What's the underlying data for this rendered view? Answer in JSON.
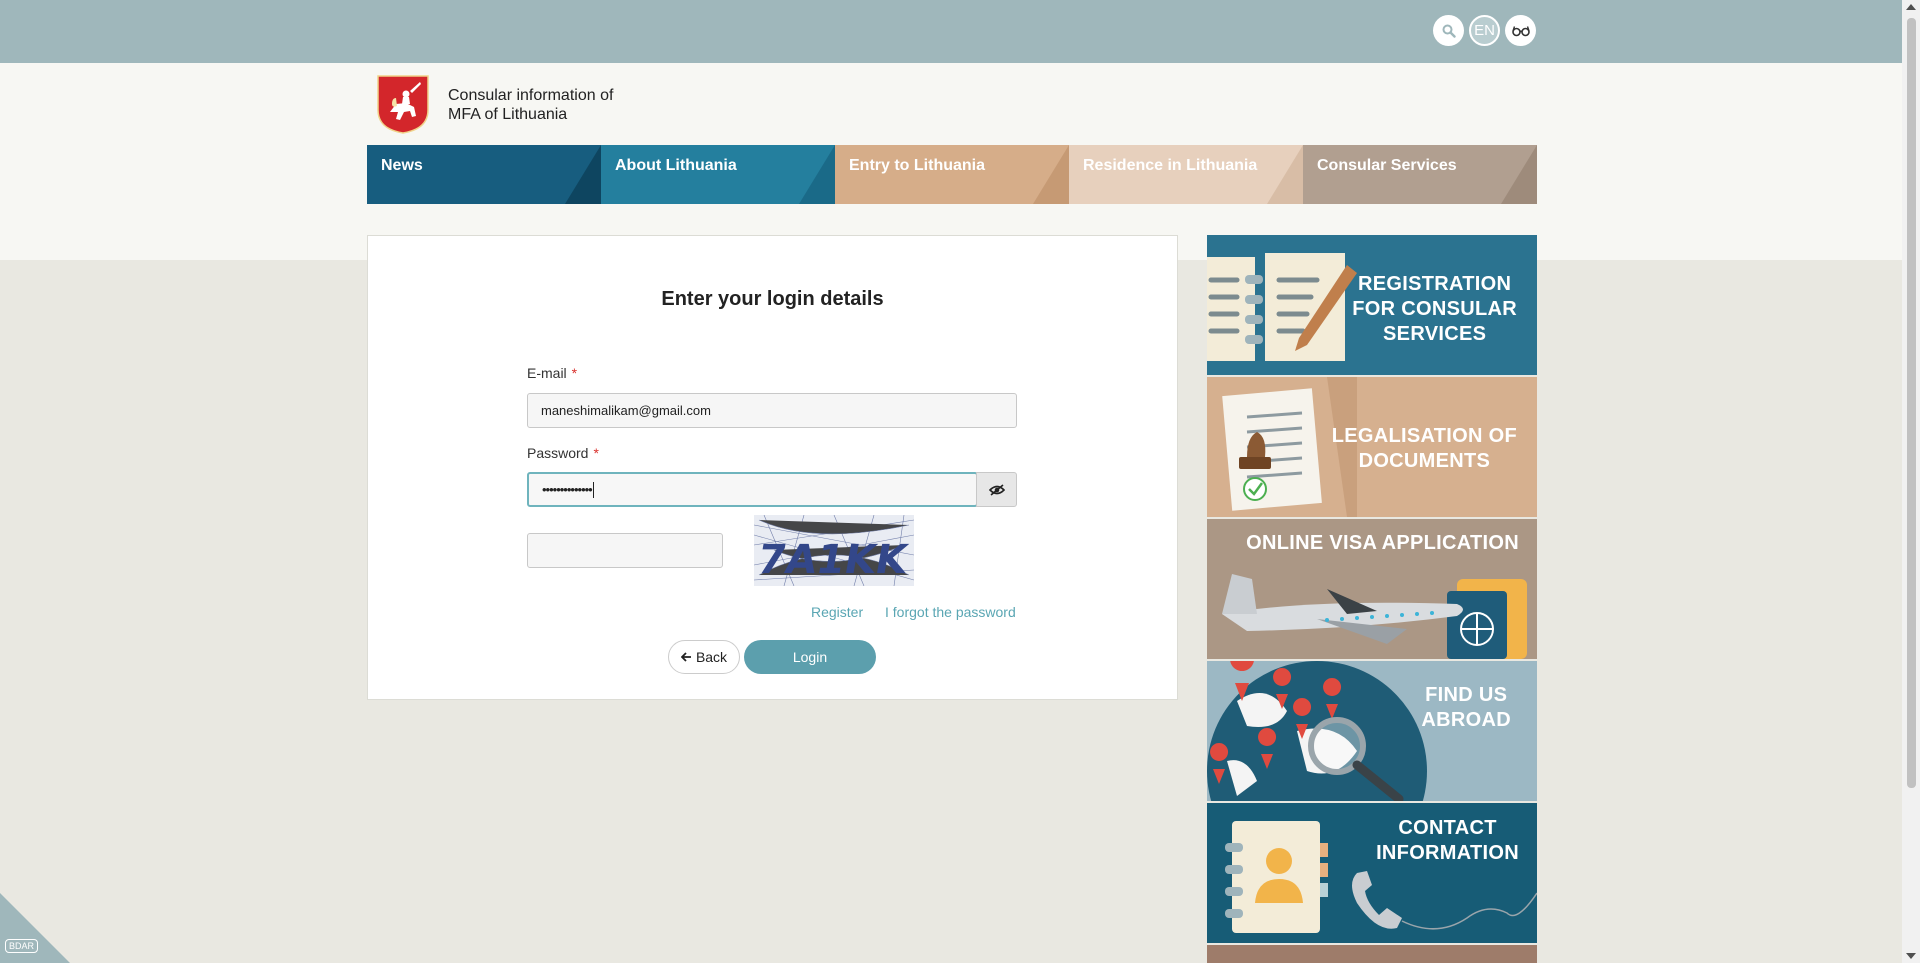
{
  "topbar": {
    "lang_label": "EN"
  },
  "header": {
    "title_line1": "Consular information of",
    "title_line2": "MFA of Lithuania"
  },
  "nav": {
    "items": [
      {
        "label": "News"
      },
      {
        "label": "About Lithuania"
      },
      {
        "label": "Entry to Lithuania"
      },
      {
        "label": "Residence in Lithuania"
      },
      {
        "label": "Consular Services"
      }
    ]
  },
  "login": {
    "title": "Enter your login details",
    "email_label": "E-mail",
    "email_value": "maneshimalikam@gmail.com",
    "password_label": "Password",
    "password_value": "••••••••••••••",
    "required_mark": "*",
    "captcha_text": "7A1KK",
    "register_link": "Register",
    "forgot_link": "I forgot the password",
    "back_button": "Back",
    "login_button": "Login"
  },
  "banners": [
    {
      "line1": "Registration",
      "line2": "for consular",
      "line3": "services"
    },
    {
      "line1": "Legalisation of",
      "line2": "documents"
    },
    {
      "line1": "Online visa application"
    },
    {
      "line1": "Find us",
      "line2": "abroad"
    },
    {
      "line1": "Contact",
      "line2": "information"
    }
  ],
  "corner_badge": "BDAR",
  "colors": {
    "topbar": "#9fb7bb",
    "nav_news": "#175d7f",
    "nav_about": "#247f9e",
    "nav_entry": "#d6ad89",
    "nav_residence": "#e7d0bd",
    "nav_consular": "#b19f90",
    "login_button": "#5c9fad",
    "link": "#5aa6b3"
  }
}
